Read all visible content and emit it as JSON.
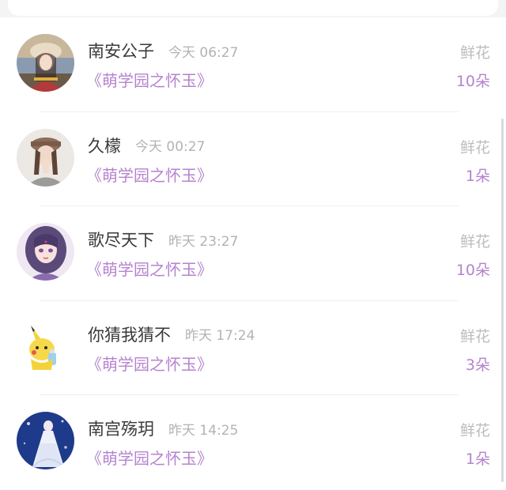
{
  "gifts": [
    {
      "name": "南安公子",
      "time": "今天 06:27",
      "book": "《萌学园之怀玉》",
      "gift_type": "鲜花",
      "count": "10朵",
      "avatar": "girl-with-hat-avatar"
    },
    {
      "name": "久檬",
      "time": "今天 00:27",
      "book": "《萌学园之怀玉》",
      "gift_type": "鲜花",
      "count": "1朵",
      "avatar": "girl-praying-avatar"
    },
    {
      "name": "歌尽天下",
      "time": "昨天 23:27",
      "book": "《萌学园之怀玉》",
      "gift_type": "鲜花",
      "count": "10朵",
      "avatar": "anime-princess-avatar"
    },
    {
      "name": "你猜我猜不",
      "time": "昨天 17:24",
      "book": "《萌学园之怀玉》",
      "gift_type": "鲜花",
      "count": "3朵",
      "avatar": "pikachu-avatar"
    },
    {
      "name": "南宫殇玥",
      "time": "昨天 14:25",
      "book": "《萌学园之怀玉》",
      "gift_type": "鲜花",
      "count": "1朵",
      "avatar": "white-dress-avatar"
    }
  ],
  "colors": {
    "accent": "#b583cf",
    "name": "#3a3a3a",
    "muted": "#b3b3b3"
  }
}
